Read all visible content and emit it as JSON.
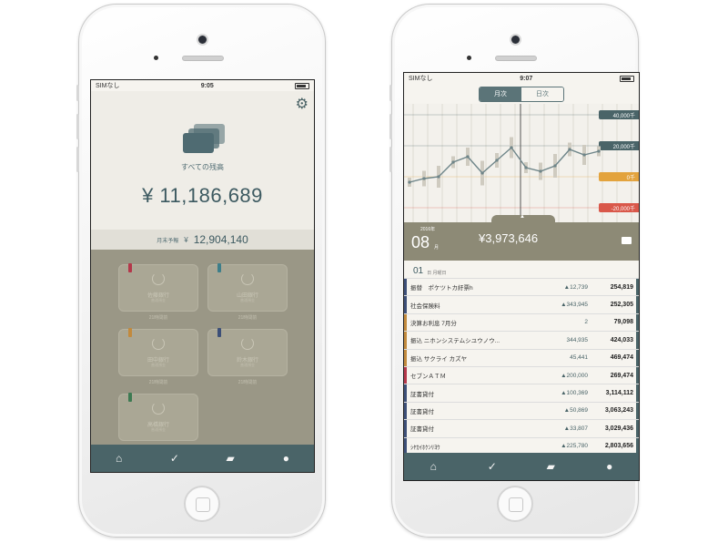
{
  "left": {
    "status": {
      "carrier": "SIMなし",
      "time": "9:05"
    },
    "caption": "すべての残高",
    "total": "¥ 11,186,689",
    "forecast": {
      "label": "月末予報",
      "yen": "¥",
      "amount": "12,904,140"
    },
    "banks": [
      {
        "name": "佐藤銀行",
        "sub": "普通預金",
        "time": "21時間前",
        "color": "#b4374a"
      },
      {
        "name": "山田銀行",
        "sub": "普通預金",
        "time": "21時間前",
        "color": "#3d7e8a"
      },
      {
        "name": "田中銀行",
        "sub": "普通預金",
        "time": "21時間前",
        "color": "#c28a3d"
      },
      {
        "name": "鈴木銀行",
        "sub": "普通預金",
        "time": "21時間前",
        "color": "#3c4f78"
      },
      {
        "name": "高橋銀行",
        "sub": "普通預金",
        "time": "",
        "color": "#3d7a52"
      }
    ],
    "tabs": [
      "home-icon",
      "chart-icon",
      "cards-icon",
      "chat-icon"
    ]
  },
  "right": {
    "status": {
      "carrier": "SIMなし",
      "time": "9:07"
    },
    "segments": {
      "monthly": "月次",
      "daily": "日次"
    },
    "chart_labels": [
      "40,000千",
      "20,000千",
      "0千",
      "-20,000千"
    ],
    "chart_label_colors": [
      "#4a6468",
      "#4a6468",
      "#e3a33d",
      "#d9584a"
    ],
    "summary": {
      "year": "2016年",
      "month": "08",
      "month_unit": "月",
      "balance": "¥3,973,646"
    },
    "day": {
      "day": "01",
      "unit": "日 月曜日"
    },
    "transactions": [
      {
        "desc": "振替　ポケツトカ紆票h",
        "change": "▲12,739",
        "balance": "254,819",
        "color": "#3d4f78"
      },
      {
        "desc": "社会保険料",
        "change": "▲343,945",
        "balance": "252,305",
        "color": "#3d4f78"
      },
      {
        "desc": "決算お利息 7月分",
        "change": "2",
        "balance": "79,098",
        "color": "#c28a3d"
      },
      {
        "desc": "振込 ニホンシステムシユウノウ...",
        "change": "344,935",
        "balance": "424,033",
        "color": "#c28a3d"
      },
      {
        "desc": "振込 サクライ カズヤ",
        "change": "45,441",
        "balance": "469,474",
        "color": "#c28a3d"
      },
      {
        "desc": "セブンＡＴＭ",
        "change": "▲200,000",
        "balance": "269,474",
        "color": "#b4374a"
      },
      {
        "desc": "証書貸付",
        "change": "▲100,369",
        "balance": "3,114,112",
        "color": "#3d4f78"
      },
      {
        "desc": "証書貸付",
        "change": "▲50,869",
        "balance": "3,063,243",
        "color": "#3d4f78"
      },
      {
        "desc": "証書貸付",
        "change": "▲33,807",
        "balance": "3,029,436",
        "color": "#3d4f78"
      },
      {
        "desc": "ｼﾔｶｲﾎｹﾝﾘﾖｳ",
        "change": "▲225,780",
        "balance": "2,803,656",
        "color": "#3d4f78"
      }
    ],
    "tabs": [
      "home-icon",
      "chart-icon",
      "cards-icon",
      "chat-icon"
    ]
  }
}
